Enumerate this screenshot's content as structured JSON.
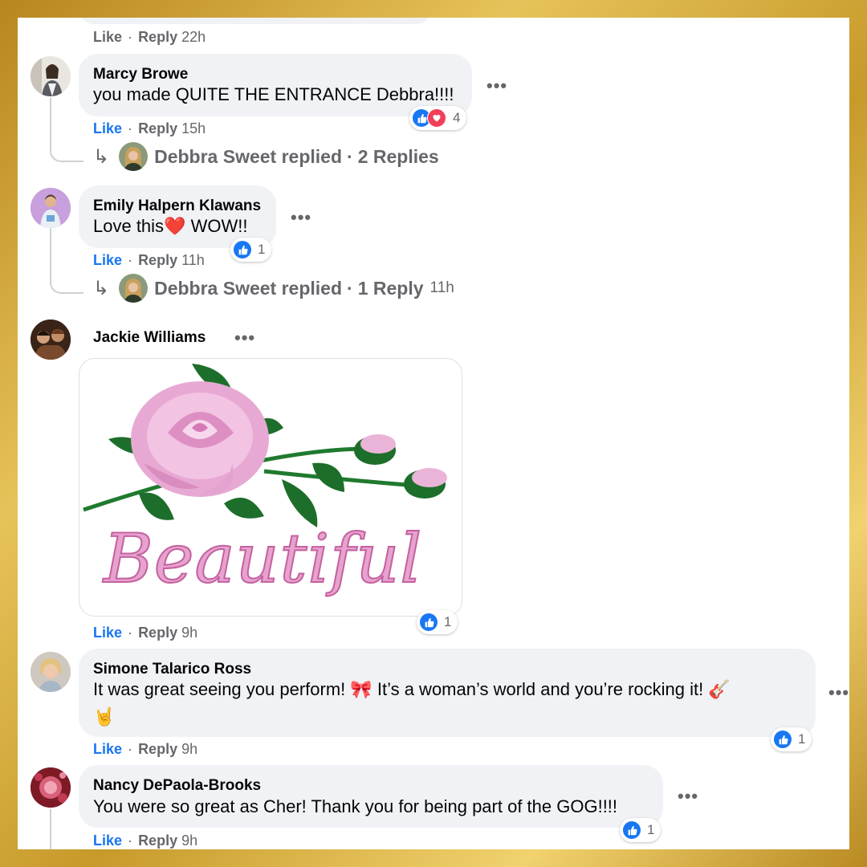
{
  "top_partial": {
    "like": "Like",
    "reply": "Reply",
    "time": "22h"
  },
  "comments": [
    {
      "author": "Marcy Browe",
      "text": "you made QUITE THE ENTRANCE Debbra!!!!",
      "like": "Like",
      "reply": "Reply",
      "time": "15h",
      "reactions": {
        "count": "4",
        "icons": [
          "like",
          "love"
        ]
      },
      "replies": {
        "name": "Debbra Sweet replied",
        "count": "2 Replies",
        "time": ""
      }
    },
    {
      "author": "Emily Halpern Klawans",
      "text_before": "Love this",
      "emoji": "❤️",
      "text_after": " WOW!!",
      "like": "Like",
      "reply": "Reply",
      "time": "11h",
      "reactions": {
        "count": "1",
        "icons": [
          "like"
        ]
      },
      "replies": {
        "name": "Debbra Sweet replied",
        "count": "1 Reply",
        "time": "11h"
      }
    },
    {
      "author": "Jackie Williams",
      "sticker_text": "Beautiful",
      "like": "Like",
      "reply": "Reply",
      "time": "9h",
      "reactions": {
        "count": "1",
        "icons": [
          "like"
        ]
      }
    },
    {
      "author": "Simone Talarico Ross",
      "text": "It was great seeing you perform! 🎀 It’s a woman’s world and you’re rocking it! 🎸",
      "text_line2": "🤘",
      "like": "Like",
      "reply": "Reply",
      "time": "9h",
      "reactions": {
        "count": "1",
        "icons": [
          "like"
        ]
      }
    },
    {
      "author": "Nancy DePaola-Brooks",
      "text": "You were so great as Cher! Thank you for being part of the GOG!!!!",
      "like": "Like",
      "reply": "Reply",
      "time": "9h",
      "reactions": {
        "count": "1",
        "icons": [
          "like"
        ]
      }
    }
  ],
  "separator": "·",
  "more_label": "•••",
  "colors": {
    "accent": "#1877f2",
    "love": "#f33e58",
    "bubble": "#f0f2f5",
    "muted": "#65676b",
    "frame": "#c79a2a"
  }
}
